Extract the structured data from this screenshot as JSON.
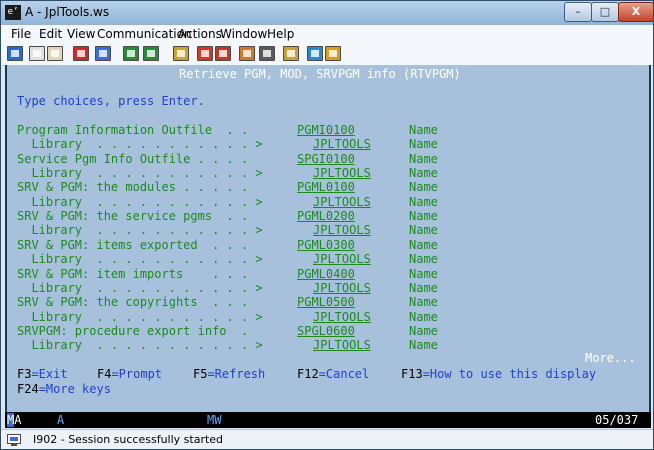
{
  "window": {
    "app_icon": "e’",
    "title": "A - JplTools.ws",
    "minimize": "–",
    "maximize": "□",
    "close": "X"
  },
  "menu": {
    "file": "File",
    "edit": "Edit",
    "view": "View",
    "communication": "Communication",
    "actions": "Actions",
    "window": "Window",
    "help": "Help"
  },
  "toolbar": {
    "icons": [
      "print-screen-icon",
      "copy-icon",
      "paste-icon",
      "send-icon",
      "receive-icon",
      "display-icon",
      "keypad-icon",
      "macro-icon",
      "record-macro-icon",
      "stop-macro-icon",
      "play-macro-icon",
      "connect-icon",
      "disconnect-icon",
      "globe-icon",
      "help-icon"
    ],
    "icon_colors": [
      "#2c6bd6",
      "#e0e0e0",
      "#e0d7b8",
      "#d0282e",
      "#3a6ed8",
      "#2a8a3a",
      "#2a8a3a",
      "#c8a430",
      "#d03a2a",
      "#c03a2a",
      "#d07a2a",
      "#5a5a5a",
      "#c8a040",
      "#2a8ad0",
      "#d0a020"
    ]
  },
  "screen": {
    "heading": "Retrieve PGM, MOD, SRVPGM info (RTVPGM)",
    "instructions": "Type choices, press Enter.",
    "fields": [
      {
        "label": "Program Information Outfile  . .",
        "value": "PGMI0100",
        "hint": "Name"
      },
      {
        "label": "  Library  . . . . . . . . . . . >",
        "value": "JPLTOOLS",
        "hint": "Name",
        "lib": true
      },
      {
        "label": "Service Pgm Info Outfile . . . .",
        "value": "SPGI0100",
        "hint": "Name"
      },
      {
        "label": "  Library  . . . . . . . . . . . >",
        "value": "JPLTOOLS",
        "hint": "Name",
        "lib": true
      },
      {
        "label": "SRV & PGM: the modules . . . . .",
        "value": "PGML0100",
        "hint": "Name"
      },
      {
        "label": "  Library  . . . . . . . . . . . >",
        "value": "JPLTOOLS",
        "hint": "Name",
        "lib": true
      },
      {
        "label": "SRV & PGM: the service pgms  . .",
        "value": "PGML0200",
        "hint": "Name"
      },
      {
        "label": "  Library  . . . . . . . . . . . >",
        "value": "JPLTOOLS",
        "hint": "Name",
        "lib": true
      },
      {
        "label": "SRV & PGM: items exported  . . .",
        "value": "PGML0300",
        "hint": "Name"
      },
      {
        "label": "  Library  . . . . . . . . . . . >",
        "value": "JPLTOOLS",
        "hint": "Name",
        "lib": true
      },
      {
        "label": "SRV & PGM: item imports    . . .",
        "value": "PGML0400",
        "hint": "Name"
      },
      {
        "label": "  Library  . . . . . . . . . . . >",
        "value": "JPLTOOLS",
        "hint": "Name",
        "lib": true
      },
      {
        "label": "SRV & PGM: the copyrights  . . .",
        "value": "PGML0500",
        "hint": "Name"
      },
      {
        "label": "  Library  . . . . . . . . . . . >",
        "value": "JPLTOOLS",
        "hint": "Name",
        "lib": true
      },
      {
        "label": "SRVPGM: procedure export info  .",
        "value": "SPGL0600",
        "hint": "Name"
      },
      {
        "label": "  Library  . . . . . . . . . . . >",
        "value": "JPLTOOLS",
        "hint": "Name",
        "lib": true
      }
    ],
    "more": "More...",
    "fkeys": [
      {
        "key": "F3",
        "desc": "=Exit"
      },
      {
        "key": "F4",
        "desc": "=Prompt"
      },
      {
        "key": "F5",
        "desc": "=Refresh"
      },
      {
        "key": "F12",
        "desc": "=Cancel"
      },
      {
        "key": "F13",
        "desc": "=How to use this display"
      },
      {
        "key": "F24",
        "desc": "=More keys"
      }
    ]
  },
  "oia": {
    "ma_m": "M",
    "ma_a": "A",
    "a": "A",
    "mw": "MW",
    "cursor_pos": "05/037"
  },
  "statusbar": {
    "text": "I902 - Session successfully started"
  }
}
